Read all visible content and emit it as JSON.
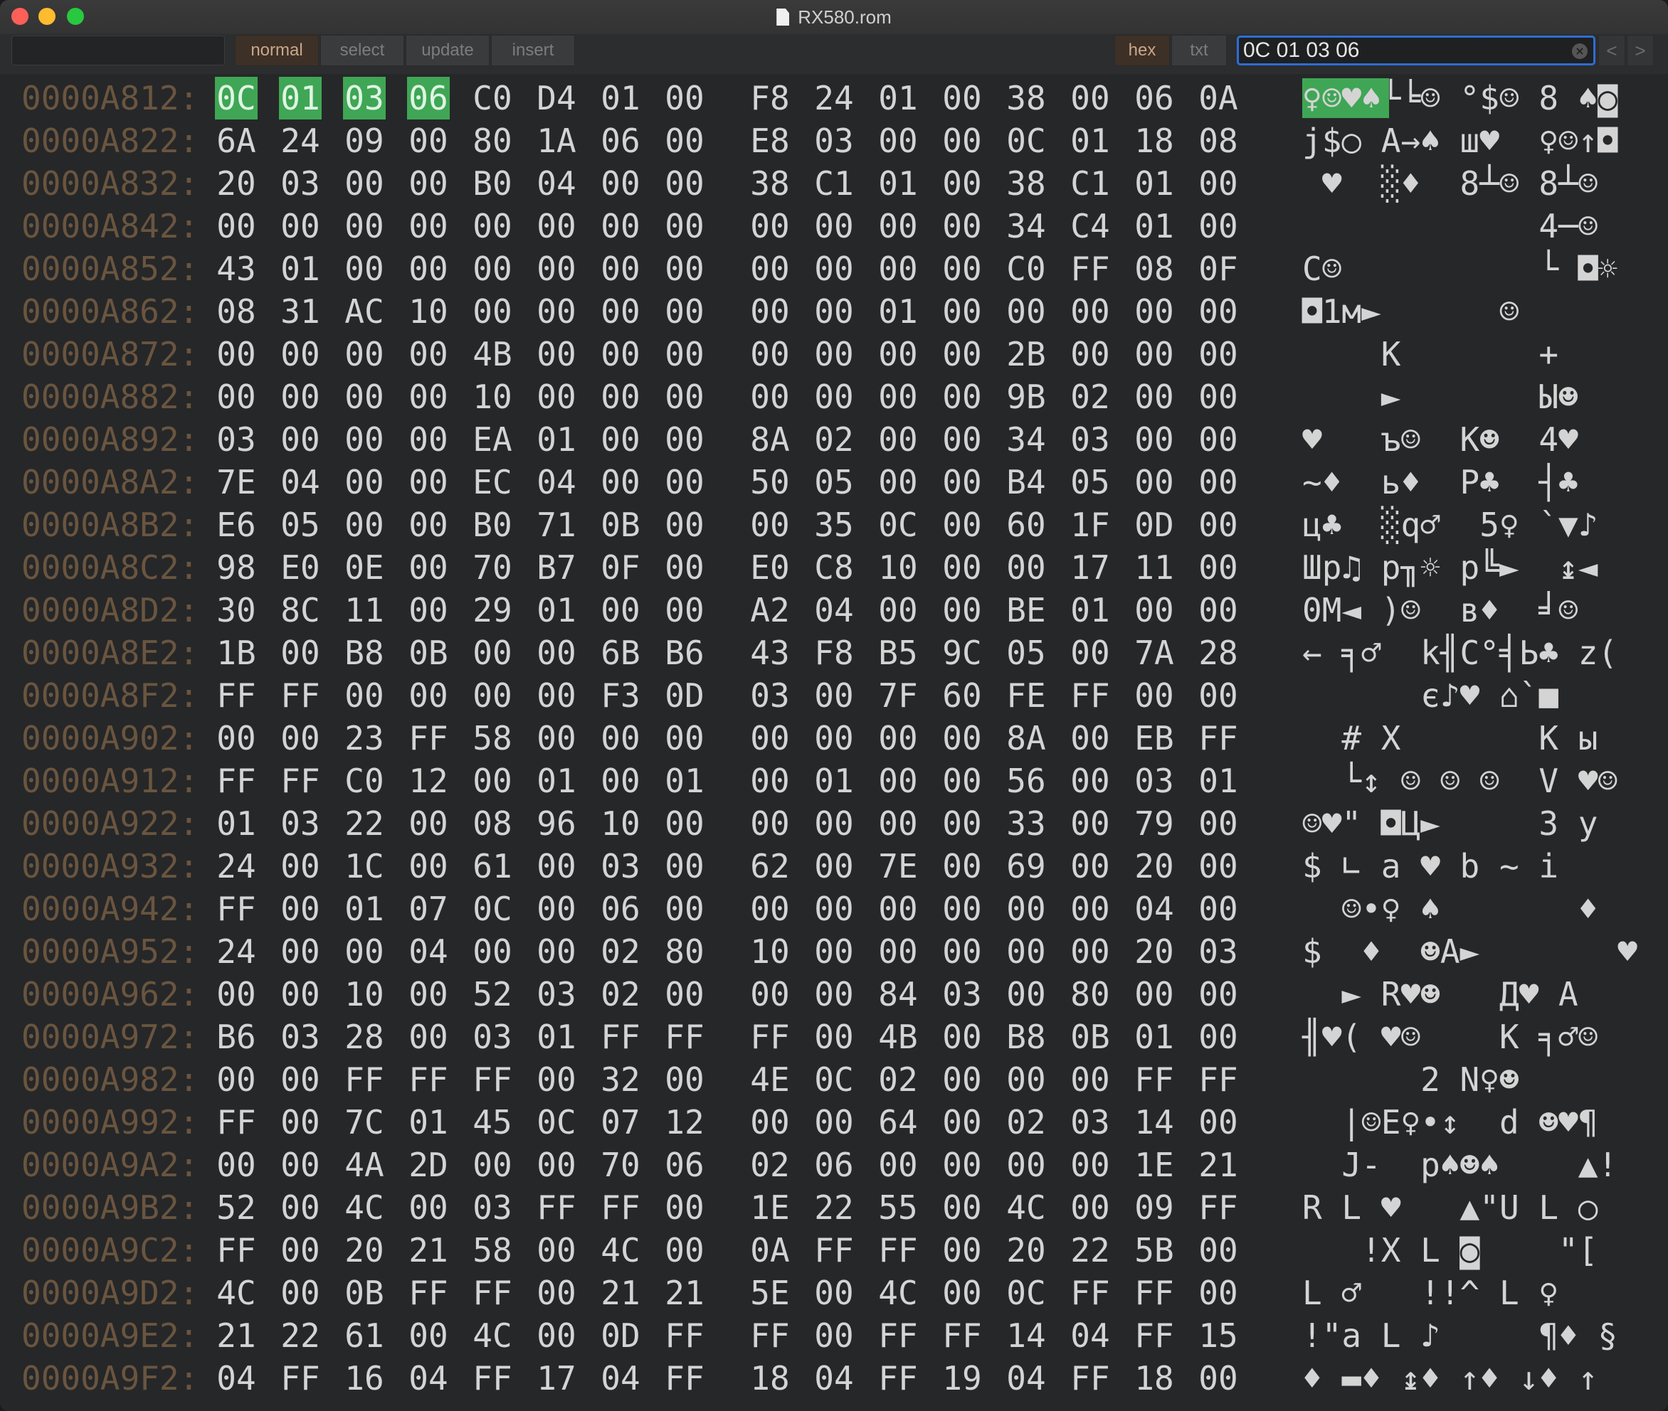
{
  "window": {
    "title": "RX580.rom"
  },
  "toolbar": {
    "command_value": "",
    "modes": [
      {
        "label": "normal",
        "active": true
      },
      {
        "label": "select",
        "active": false
      },
      {
        "label": "update",
        "active": false
      },
      {
        "label": "insert",
        "active": false
      }
    ],
    "views": [
      {
        "label": "hex",
        "active": true
      },
      {
        "label": "txt",
        "active": false
      }
    ],
    "search_value": "0C 01 03 06",
    "prev_label": "<",
    "next_label": ">"
  },
  "colors": {
    "highlight": "#3fa655",
    "address": "#6a5540",
    "text": "#d4d4d4",
    "search_border": "#2d6ed6"
  },
  "highlight": {
    "row": 0,
    "bytes": [
      0,
      1,
      2,
      3
    ]
  },
  "rows": [
    {
      "addr": "0000A812:",
      "bytes": [
        "0C",
        "01",
        "03",
        "06",
        "C0",
        "D4",
        "01",
        "00",
        "F8",
        "24",
        "01",
        "00",
        "38",
        "00",
        "06",
        "0A"
      ],
      "ascii": "♀☺♥♠└╘☺ °$☺ 8 ♠◙"
    },
    {
      "addr": "0000A822:",
      "bytes": [
        "6A",
        "24",
        "09",
        "00",
        "80",
        "1A",
        "06",
        "00",
        "E8",
        "03",
        "00",
        "00",
        "0C",
        "01",
        "18",
        "08"
      ],
      "ascii": "j$○ А→♠ ш♥  ♀☺↑◘"
    },
    {
      "addr": "0000A832:",
      "bytes": [
        "20",
        "03",
        "00",
        "00",
        "B0",
        "04",
        "00",
        "00",
        "38",
        "C1",
        "01",
        "00",
        "38",
        "C1",
        "01",
        "00"
      ],
      "ascii": " ♥  ░♦  8┴☺ 8┴☺ "
    },
    {
      "addr": "0000A842:",
      "bytes": [
        "00",
        "00",
        "00",
        "00",
        "00",
        "00",
        "00",
        "00",
        "00",
        "00",
        "00",
        "00",
        "34",
        "C4",
        "01",
        "00"
      ],
      "ascii": "            4─☺ "
    },
    {
      "addr": "0000A852:",
      "bytes": [
        "43",
        "01",
        "00",
        "00",
        "00",
        "00",
        "00",
        "00",
        "00",
        "00",
        "00",
        "00",
        "C0",
        "FF",
        "08",
        "0F"
      ],
      "ascii": "C☺          └ ◘☼"
    },
    {
      "addr": "0000A862:",
      "bytes": [
        "08",
        "31",
        "AC",
        "10",
        "00",
        "00",
        "00",
        "00",
        "00",
        "00",
        "01",
        "00",
        "00",
        "00",
        "00",
        "00"
      ],
      "ascii": "◘1м►      ☺     "
    },
    {
      "addr": "0000A872:",
      "bytes": [
        "00",
        "00",
        "00",
        "00",
        "4B",
        "00",
        "00",
        "00",
        "00",
        "00",
        "00",
        "00",
        "2B",
        "00",
        "00",
        "00"
      ],
      "ascii": "    K       +   "
    },
    {
      "addr": "0000A882:",
      "bytes": [
        "00",
        "00",
        "00",
        "00",
        "10",
        "00",
        "00",
        "00",
        "00",
        "00",
        "00",
        "00",
        "9B",
        "02",
        "00",
        "00"
      ],
      "ascii": "    ►       Ы☻  "
    },
    {
      "addr": "0000A892:",
      "bytes": [
        "03",
        "00",
        "00",
        "00",
        "EA",
        "01",
        "00",
        "00",
        "8A",
        "02",
        "00",
        "00",
        "34",
        "03",
        "00",
        "00"
      ],
      "ascii": "♥   ъ☺  К☻  4♥  "
    },
    {
      "addr": "0000A8A2:",
      "bytes": [
        "7E",
        "04",
        "00",
        "00",
        "EC",
        "04",
        "00",
        "00",
        "50",
        "05",
        "00",
        "00",
        "B4",
        "05",
        "00",
        "00"
      ],
      "ascii": "~♦  ь♦  P♣  ┤♣  "
    },
    {
      "addr": "0000A8B2:",
      "bytes": [
        "E6",
        "05",
        "00",
        "00",
        "B0",
        "71",
        "0B",
        "00",
        "00",
        "35",
        "0C",
        "00",
        "60",
        "1F",
        "0D",
        "00"
      ],
      "ascii": "ц♣  ░q♂  5♀ `▼♪ "
    },
    {
      "addr": "0000A8C2:",
      "bytes": [
        "98",
        "E0",
        "0E",
        "00",
        "70",
        "B7",
        "0F",
        "00",
        "E0",
        "C8",
        "10",
        "00",
        "00",
        "17",
        "11",
        "00"
      ],
      "ascii": "Шр♫ p╖☼ р╚►  ↨◄ "
    },
    {
      "addr": "0000A8D2:",
      "bytes": [
        "30",
        "8C",
        "11",
        "00",
        "29",
        "01",
        "00",
        "00",
        "A2",
        "04",
        "00",
        "00",
        "BE",
        "01",
        "00",
        "00"
      ],
      "ascii": "0М◄ )☺  в♦  ╛☺  "
    },
    {
      "addr": "0000A8E2:",
      "bytes": [
        "1B",
        "00",
        "B8",
        "0B",
        "00",
        "00",
        "6B",
        "B6",
        "43",
        "F8",
        "B5",
        "9C",
        "05",
        "00",
        "7A",
        "28"
      ],
      "ascii": "← ╕♂  k╢C°╡Ь♣ z("
    },
    {
      "addr": "0000A8F2:",
      "bytes": [
        "FF",
        "FF",
        "00",
        "00",
        "00",
        "00",
        "F3",
        "0D",
        "03",
        "00",
        "7F",
        "60",
        "FE",
        "FF",
        "00",
        "00"
      ],
      "ascii": "      є♪♥ ⌂`■   "
    },
    {
      "addr": "0000A902:",
      "bytes": [
        "00",
        "00",
        "23",
        "FF",
        "58",
        "00",
        "00",
        "00",
        "00",
        "00",
        "00",
        "00",
        "8A",
        "00",
        "EB",
        "FF"
      ],
      "ascii": "  # X       К ы "
    },
    {
      "addr": "0000A912:",
      "bytes": [
        "FF",
        "FF",
        "C0",
        "12",
        "00",
        "01",
        "00",
        "01",
        "00",
        "01",
        "00",
        "00",
        "56",
        "00",
        "03",
        "01"
      ],
      "ascii": "  └↕ ☺ ☺ ☺  V ♥☺"
    },
    {
      "addr": "0000A922:",
      "bytes": [
        "01",
        "03",
        "22",
        "00",
        "08",
        "96",
        "10",
        "00",
        "00",
        "00",
        "00",
        "00",
        "33",
        "00",
        "79",
        "00"
      ],
      "ascii": "☺♥\" ◘Ц►     3 y "
    },
    {
      "addr": "0000A932:",
      "bytes": [
        "24",
        "00",
        "1C",
        "00",
        "61",
        "00",
        "03",
        "00",
        "62",
        "00",
        "7E",
        "00",
        "69",
        "00",
        "20",
        "00"
      ],
      "ascii": "$ ∟ a ♥ b ~ i   "
    },
    {
      "addr": "0000A942:",
      "bytes": [
        "FF",
        "00",
        "01",
        "07",
        "0C",
        "00",
        "06",
        "00",
        "00",
        "00",
        "00",
        "00",
        "00",
        "00",
        "04",
        "00"
      ],
      "ascii": "  ☺•♀ ♠       ♦ "
    },
    {
      "addr": "0000A952:",
      "bytes": [
        "24",
        "00",
        "00",
        "04",
        "00",
        "00",
        "02",
        "80",
        "10",
        "00",
        "00",
        "00",
        "00",
        "00",
        "20",
        "03"
      ],
      "ascii": "$  ♦  ☻А►       ♥"
    },
    {
      "addr": "0000A962:",
      "bytes": [
        "00",
        "00",
        "10",
        "00",
        "52",
        "03",
        "02",
        "00",
        "00",
        "00",
        "84",
        "03",
        "00",
        "80",
        "00",
        "00"
      ],
      "ascii": "  ► R♥☻   Д♥ А  "
    },
    {
      "addr": "0000A972:",
      "bytes": [
        "B6",
        "03",
        "28",
        "00",
        "03",
        "01",
        "FF",
        "FF",
        "FF",
        "00",
        "4B",
        "00",
        "B8",
        "0B",
        "01",
        "00"
      ],
      "ascii": "╢♥( ♥☺    K ╕♂☺ "
    },
    {
      "addr": "0000A982:",
      "bytes": [
        "00",
        "00",
        "FF",
        "FF",
        "FF",
        "00",
        "32",
        "00",
        "4E",
        "0C",
        "02",
        "00",
        "00",
        "00",
        "FF",
        "FF"
      ],
      "ascii": "      2 N♀☻     "
    },
    {
      "addr": "0000A992:",
      "bytes": [
        "FF",
        "00",
        "7C",
        "01",
        "45",
        "0C",
        "07",
        "12",
        "00",
        "00",
        "64",
        "00",
        "02",
        "03",
        "14",
        "00"
      ],
      "ascii": "  |☺E♀•↕  d ☻♥¶ "
    },
    {
      "addr": "0000A9A2:",
      "bytes": [
        "00",
        "00",
        "4A",
        "2D",
        "00",
        "00",
        "70",
        "06",
        "02",
        "06",
        "00",
        "00",
        "00",
        "00",
        "1E",
        "21"
      ],
      "ascii": "  J-  p♠☻♠    ▲!"
    },
    {
      "addr": "0000A9B2:",
      "bytes": [
        "52",
        "00",
        "4C",
        "00",
        "03",
        "FF",
        "FF",
        "00",
        "1E",
        "22",
        "55",
        "00",
        "4C",
        "00",
        "09",
        "FF"
      ],
      "ascii": "R L ♥   ▲\"U L ○ "
    },
    {
      "addr": "0000A9C2:",
      "bytes": [
        "FF",
        "00",
        "20",
        "21",
        "58",
        "00",
        "4C",
        "00",
        "0A",
        "FF",
        "FF",
        "00",
        "20",
        "22",
        "5B",
        "00"
      ],
      "ascii": "   !X L ◙    \"[ "
    },
    {
      "addr": "0000A9D2:",
      "bytes": [
        "4C",
        "00",
        "0B",
        "FF",
        "FF",
        "00",
        "21",
        "21",
        "5E",
        "00",
        "4C",
        "00",
        "0C",
        "FF",
        "FF",
        "00"
      ],
      "ascii": "L ♂   !!^ L ♀   "
    },
    {
      "addr": "0000A9E2:",
      "bytes": [
        "21",
        "22",
        "61",
        "00",
        "4C",
        "00",
        "0D",
        "FF",
        "FF",
        "00",
        "FF",
        "FF",
        "14",
        "04",
        "FF",
        "15"
      ],
      "ascii": "!\"a L ♪     ¶♦ §"
    },
    {
      "addr": "0000A9F2:",
      "bytes": [
        "04",
        "FF",
        "16",
        "04",
        "FF",
        "17",
        "04",
        "FF",
        "18",
        "04",
        "FF",
        "19",
        "04",
        "FF",
        "18",
        "00"
      ],
      "ascii": "♦ ▬♦ ↨♦ ↑♦ ↓♦ ↑ "
    }
  ]
}
